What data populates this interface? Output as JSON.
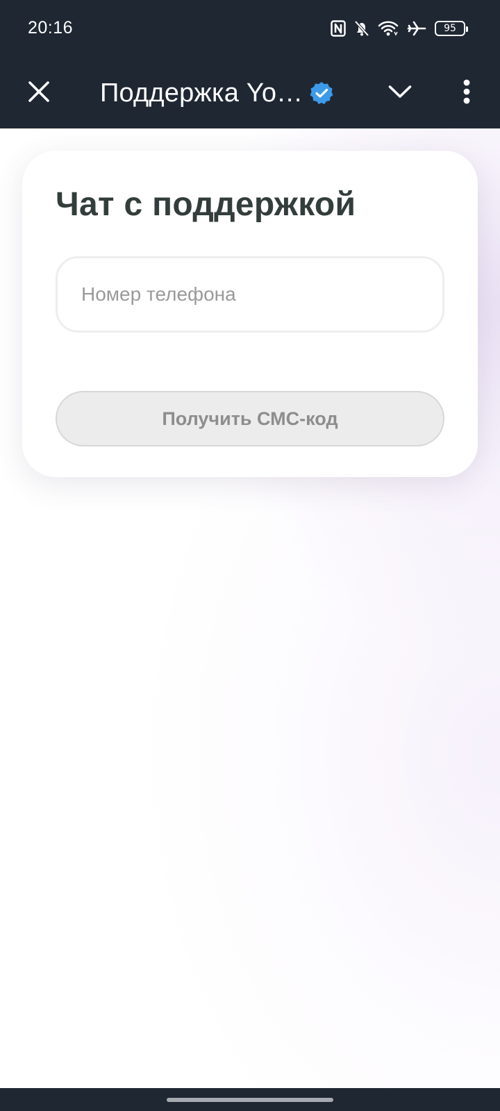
{
  "status_bar": {
    "time": "20:16",
    "battery_level": "95",
    "icons": [
      "nfc-icon",
      "bell-off-icon",
      "wifi-icon",
      "airplane-icon",
      "battery-icon"
    ]
  },
  "app_bar": {
    "title": "Поддержка Yo…",
    "icons": [
      "close-icon",
      "verified-badge-icon",
      "chevron-down-icon",
      "more-vert-icon"
    ]
  },
  "card": {
    "title": "Чат с поддержкой",
    "phone_input": {
      "value": "",
      "placeholder": "Номер телефона"
    },
    "sms_button_label": "Получить СМС-код"
  },
  "colors": {
    "bar_background": "#1f2733",
    "title_text": "#333d3b",
    "verified_badge": "#3d9ae8",
    "button_disabled_bg": "#ececec",
    "button_disabled_text": "#8d8d8d"
  }
}
